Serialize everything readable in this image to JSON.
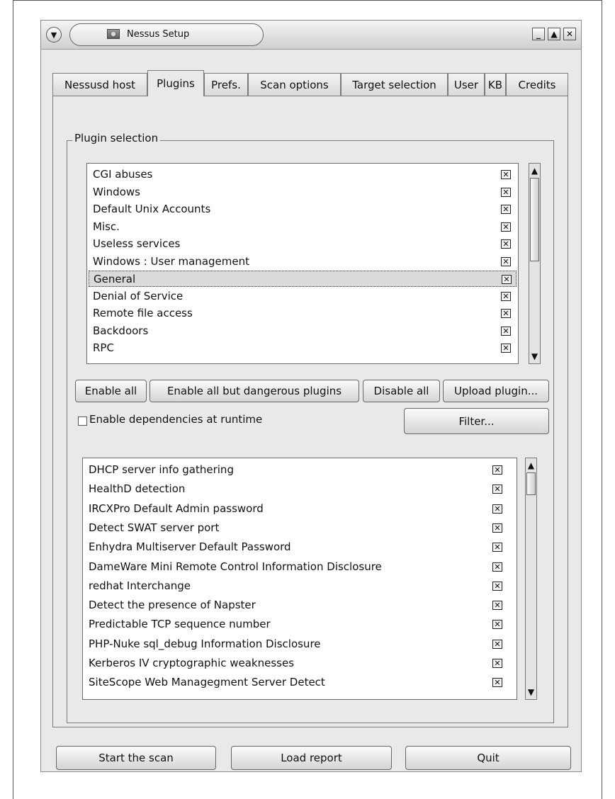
{
  "window": {
    "title": "Nessus Setup",
    "controls": {
      "menu_icon": "chevron-down-icon",
      "minimize_icon": "minimize-icon",
      "maximize_icon": "maximize-icon",
      "close_icon": "close-icon"
    }
  },
  "tabs": [
    {
      "label": "Nessusd host",
      "active": false
    },
    {
      "label": "Plugins",
      "active": true
    },
    {
      "label": "Prefs.",
      "active": false
    },
    {
      "label": "Scan options",
      "active": false
    },
    {
      "label": "Target selection",
      "active": false
    },
    {
      "label": "User",
      "active": false
    },
    {
      "label": "KB",
      "active": false
    },
    {
      "label": "Credits",
      "active": false
    }
  ],
  "plugin_selection": {
    "group_label": "Plugin selection",
    "families": [
      {
        "name": "CGI abuses",
        "enabled": true
      },
      {
        "name": "Windows",
        "enabled": true
      },
      {
        "name": "Default Unix Accounts",
        "enabled": true
      },
      {
        "name": "Misc.",
        "enabled": true
      },
      {
        "name": "Useless services",
        "enabled": true
      },
      {
        "name": "Windows : User management",
        "enabled": true
      },
      {
        "name": "General",
        "enabled": true,
        "selected": true
      },
      {
        "name": "Denial of Service",
        "enabled": true
      },
      {
        "name": "Remote file access",
        "enabled": true
      },
      {
        "name": "Backdoors",
        "enabled": true
      },
      {
        "name": "RPC",
        "enabled": true
      }
    ],
    "buttons": {
      "enable_all": "Enable all",
      "enable_safe": "Enable all but dangerous plugins",
      "disable_all": "Disable all",
      "upload": "Upload plugin..."
    },
    "dependencies_label": "Enable dependencies at runtime",
    "dependencies_checked": false,
    "filter_label": "Filter...",
    "plugins": [
      {
        "name": "DHCP server info gathering",
        "enabled": true
      },
      {
        "name": "HealthD detection",
        "enabled": true
      },
      {
        "name": "IRCXPro Default Admin password",
        "enabled": true
      },
      {
        "name": "Detect SWAT server port",
        "enabled": true
      },
      {
        "name": "Enhydra Multiserver Default Password",
        "enabled": true
      },
      {
        "name": "DameWare Mini Remote Control Information Disclosure",
        "enabled": true
      },
      {
        "name": "redhat Interchange",
        "enabled": true
      },
      {
        "name": "Detect the presence of Napster",
        "enabled": true
      },
      {
        "name": "Predictable TCP sequence number",
        "enabled": true
      },
      {
        "name": "PHP-Nuke sql_debug Information Disclosure",
        "enabled": true
      },
      {
        "name": "Kerberos IV cryptographic weaknesses",
        "enabled": true
      },
      {
        "name": "SiteScope Web Managegment Server Detect",
        "enabled": true
      }
    ]
  },
  "footer": {
    "start_scan": "Start the scan",
    "load_report": "Load report",
    "quit": "Quit"
  },
  "icons": {
    "checked_box": "x-checkbox-icon",
    "scroll_up": "arrow-up-icon",
    "scroll_down": "arrow-down-icon"
  }
}
